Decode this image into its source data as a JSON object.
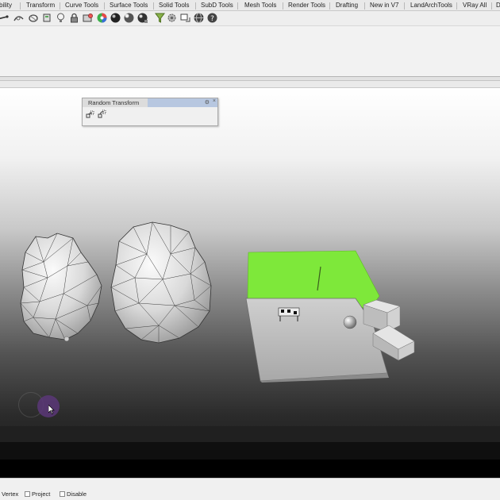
{
  "tabs": [
    {
      "label": "bility"
    },
    {
      "label": "Transform"
    },
    {
      "label": "Curve Tools"
    },
    {
      "label": "Surface Tools"
    },
    {
      "label": "Solid Tools"
    },
    {
      "label": "SubD Tools"
    },
    {
      "label": "Mesh Tools"
    },
    {
      "label": "Render Tools"
    },
    {
      "label": "Drafting"
    },
    {
      "label": "New in V7"
    },
    {
      "label": "LandArchTools"
    },
    {
      "label": "VRay All"
    },
    {
      "label": "D"
    }
  ],
  "toolbar_icons": [
    "line-tool-icon",
    "analyze-curve-icon",
    "loft-icon",
    "shell-icon",
    "lightbulb-icon",
    "lock-icon",
    "hide-object-icon",
    "color-wheel-icon",
    "render-sphere-icon",
    "shaded-sphere-icon",
    "rendered-sphere-icon",
    "material-sphere-icon",
    "filter-icon",
    "settings-gear-icon",
    "named-views-icon",
    "globe-render-icon",
    "help-icon"
  ],
  "panel": {
    "title": "Random Transform",
    "gear": "⚙",
    "close": "×"
  },
  "status": {
    "osnaps": [
      {
        "label": "Vertex",
        "checked": false
      },
      {
        "label": "Project",
        "checked": false
      },
      {
        "label": "Disable",
        "checked": false
      }
    ]
  },
  "colors": {
    "accent_green": "#7ee83a",
    "selection_blue": "#b7c7e0",
    "cursor_halo": "#5a3778"
  }
}
